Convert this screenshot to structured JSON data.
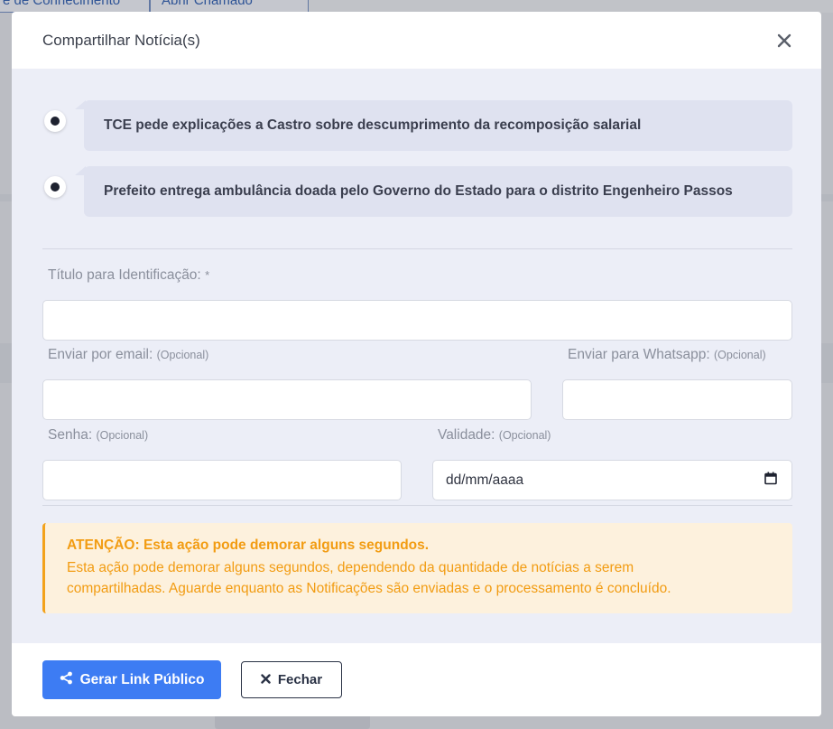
{
  "background": {
    "tab_1": "e de Conhecimento",
    "tab_2": "Abrir Chamado"
  },
  "modal": {
    "title": "Compartilhar Notícia(s)",
    "news": [
      {
        "title": "TCE pede explicações a Castro sobre descumprimento da recomposição salarial",
        "selected": true
      },
      {
        "title": "Prefeito entrega ambulância doada pelo Governo do Estado para o distrito Engenheiro Passos",
        "selected": true
      }
    ],
    "form": {
      "title_label": "Título para Identificação:",
      "title_required": "*",
      "title_value": "",
      "email_label": "Enviar por email:",
      "email_optional": "(Opcional)",
      "email_value": "",
      "whatsapp_label": "Enviar para Whatsapp:",
      "whatsapp_optional": "(Opcional)",
      "whatsapp_value": "",
      "password_label": "Senha:",
      "password_optional": "(Opcional)",
      "password_value": "",
      "validity_label": "Validade:",
      "validity_optional": "(Opcional)",
      "validity_placeholder": "dd/mm/aaaa"
    },
    "alert": {
      "title": "ATENÇÃO: Esta ação pode demorar alguns segundos.",
      "text": "Esta ação pode demorar alguns segundos, dependendo da quantidade de notícias a serem compartilhadas. Aguarde enquanto as Notificações são enviadas e o processamento é concluído."
    },
    "footer": {
      "primary_label": "Gerar Link Público",
      "close_label": "Fechar"
    }
  },
  "colors": {
    "primary": "#3d7cf3",
    "warning": "#f29c12",
    "body_bg": "#eceef7"
  }
}
